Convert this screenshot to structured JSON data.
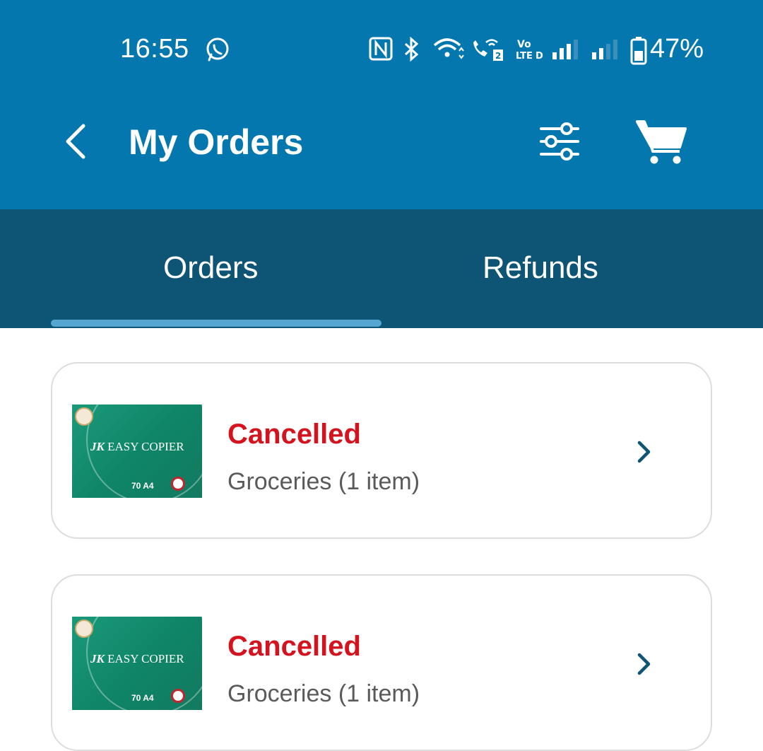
{
  "status_bar": {
    "time": "16:55",
    "battery_percent": "47%",
    "icons": [
      "whatsapp-icon",
      "nfc-icon",
      "bluetooth-icon",
      "wifi-icon",
      "wifi-calling-icon",
      "volte-icon",
      "signal-icon",
      "signal-icon",
      "battery-icon"
    ]
  },
  "app_bar": {
    "title": "My Orders",
    "icons": [
      "back-icon",
      "filter-icon",
      "cart-icon"
    ],
    "background": "#0477ae"
  },
  "tabs": {
    "items": [
      {
        "label": "Orders",
        "selected": true
      },
      {
        "label": "Refunds",
        "selected": false
      }
    ],
    "background": "#0d5475",
    "indicator_color": "#55a7d2"
  },
  "orders": [
    {
      "status": "Cancelled",
      "description": "Groceries (1 item)",
      "thumbnail": {
        "brand": "JK",
        "product": "EASY COPIER",
        "detail": "70 A4"
      }
    },
    {
      "status": "Cancelled",
      "description": "Groceries (1 item)",
      "thumbnail": {
        "brand": "JK",
        "product": "EASY COPIER",
        "detail": "70 A4"
      }
    }
  ],
  "colors": {
    "status_cancelled": "#d4131e",
    "chevron": "#0d5475"
  }
}
